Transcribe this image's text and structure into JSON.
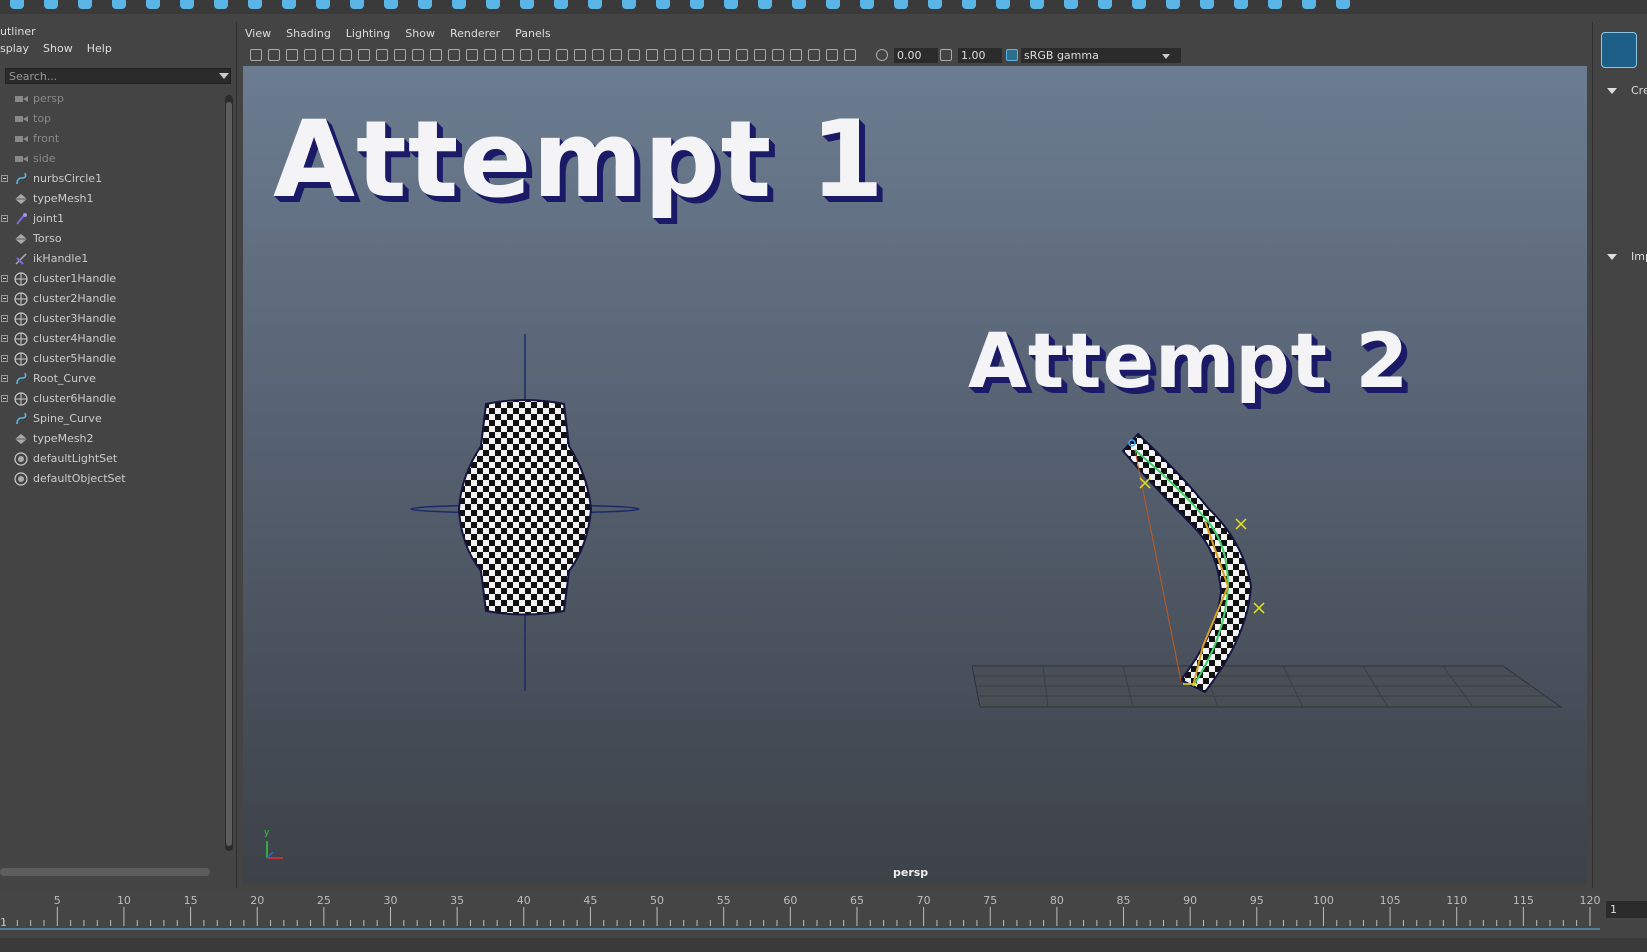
{
  "outliner": {
    "title": "utliner",
    "menu": [
      "splay",
      "Show",
      "Help"
    ],
    "search_placeholder": "Search...",
    "items": [
      {
        "label": "persp",
        "icon": "camera-icon",
        "dim": true,
        "expandable": false
      },
      {
        "label": "top",
        "icon": "camera-icon",
        "dim": true,
        "expandable": false
      },
      {
        "label": "front",
        "icon": "camera-icon",
        "dim": true,
        "expandable": false
      },
      {
        "label": "side",
        "icon": "camera-icon",
        "dim": true,
        "expandable": false
      },
      {
        "label": "nurbsCircle1",
        "icon": "curve-icon",
        "dim": false,
        "expandable": true
      },
      {
        "label": "typeMesh1",
        "icon": "mesh-icon",
        "dim": false,
        "expandable": false
      },
      {
        "label": "joint1",
        "icon": "joint-icon",
        "dim": false,
        "expandable": true
      },
      {
        "label": "Torso",
        "icon": "mesh-icon",
        "dim": false,
        "expandable": false
      },
      {
        "label": "ikHandle1",
        "icon": "ik-handle-icon",
        "dim": false,
        "expandable": false
      },
      {
        "label": "cluster1Handle",
        "icon": "cluster-icon",
        "dim": false,
        "expandable": true
      },
      {
        "label": "cluster2Handle",
        "icon": "cluster-icon",
        "dim": false,
        "expandable": true
      },
      {
        "label": "cluster3Handle",
        "icon": "cluster-icon",
        "dim": false,
        "expandable": true
      },
      {
        "label": "cluster4Handle",
        "icon": "cluster-icon",
        "dim": false,
        "expandable": true
      },
      {
        "label": "cluster5Handle",
        "icon": "cluster-icon",
        "dim": false,
        "expandable": true
      },
      {
        "label": "Root_Curve",
        "icon": "curve-icon",
        "dim": false,
        "expandable": true
      },
      {
        "label": "cluster6Handle",
        "icon": "cluster-icon",
        "dim": false,
        "expandable": true
      },
      {
        "label": "Spine_Curve",
        "icon": "curve-icon",
        "dim": false,
        "expandable": false
      },
      {
        "label": "typeMesh2",
        "icon": "mesh-icon",
        "dim": false,
        "expandable": false
      },
      {
        "label": "defaultLightSet",
        "icon": "set-icon",
        "dim": false,
        "expandable": false
      },
      {
        "label": "defaultObjectSet",
        "icon": "set-icon",
        "dim": false,
        "expandable": false
      }
    ]
  },
  "panel_menu": [
    "View",
    "Shading",
    "Lighting",
    "Show",
    "Renderer",
    "Panels"
  ],
  "toolbar": {
    "exposure": "0.00",
    "gamma": "1.00",
    "color_space": "sRGB gamma"
  },
  "viewport": {
    "text_attempt1": "Attempt 1",
    "text_attempt2": "Attempt 2",
    "camera_label": "persp",
    "axis_y": "y"
  },
  "right_panel": {
    "section1": "Cre",
    "section2": "Imp"
  },
  "timeline": {
    "ticks": [
      5,
      10,
      15,
      20,
      25,
      30,
      35,
      40,
      45,
      50,
      55,
      60,
      65,
      70,
      75,
      80,
      85,
      90,
      95,
      100,
      105,
      110,
      115,
      120
    ],
    "start_label": "1",
    "current_frame": "1"
  },
  "colors": {
    "accent": "#5ab4e6",
    "text_shadow": "#1a1a66",
    "curve": "#44aaff"
  }
}
